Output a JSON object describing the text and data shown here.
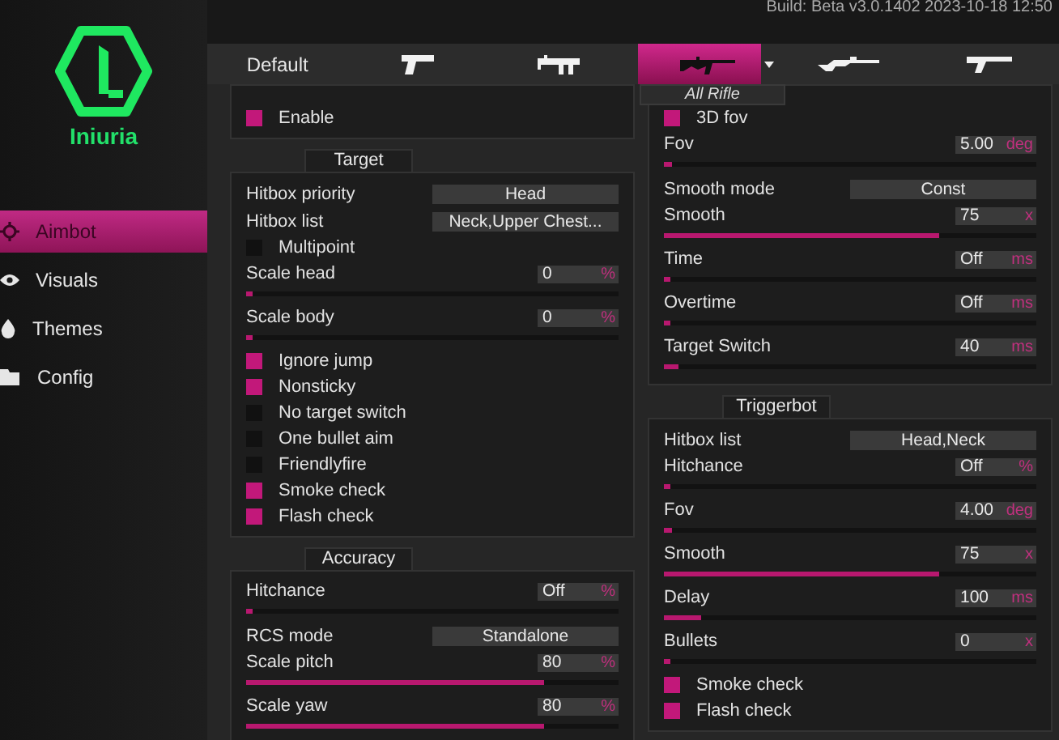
{
  "brand": {
    "name": "Iniuria"
  },
  "build": "Build: Beta v3.0.1402 2023-10-18 12:50",
  "nav": [
    {
      "label": "Aimbot",
      "selected": true
    },
    {
      "label": "Visuals",
      "selected": false
    },
    {
      "label": "Themes",
      "selected": false
    },
    {
      "label": "Config",
      "selected": false
    }
  ],
  "weapon_tabs": [
    {
      "kind": "text",
      "label": "Default",
      "selected": false
    },
    {
      "kind": "pistol",
      "selected": false
    },
    {
      "kind": "smg",
      "selected": false
    },
    {
      "kind": "rifle",
      "selected": true
    },
    {
      "kind": "sniper",
      "selected": false
    },
    {
      "kind": "heavy",
      "selected": false
    }
  ],
  "weapon_dropdown": {
    "label": "All Rifle"
  },
  "columns": [
    {
      "groups": [
        {
          "rows": [
            {
              "kind": "checkbox",
              "label": "Enable",
              "checked": true
            }
          ]
        },
        {
          "title": "Target",
          "rows": [
            {
              "kind": "select",
              "label": "Hitbox priority",
              "value": "Head"
            },
            {
              "kind": "select",
              "label": "Hitbox list",
              "value": "Neck,Upper Chest..."
            },
            {
              "kind": "checkbox",
              "label": "Multipoint",
              "checked": false
            },
            {
              "kind": "slider",
              "label": "Scale head",
              "value": "0",
              "unit": "%",
              "level": 0.0
            },
            {
              "kind": "slider",
              "label": "Scale body",
              "value": "0",
              "unit": "%",
              "level": 0.0
            },
            {
              "kind": "checkbox",
              "label": "Ignore jump",
              "checked": true
            },
            {
              "kind": "checkbox",
              "label": "Nonsticky",
              "checked": true
            },
            {
              "kind": "checkbox",
              "label": "No target switch",
              "checked": false
            },
            {
              "kind": "checkbox",
              "label": "One bullet aim",
              "checked": false
            },
            {
              "kind": "checkbox",
              "label": "Friendlyfire",
              "checked": false
            },
            {
              "kind": "checkbox",
              "label": "Smoke check",
              "checked": true
            },
            {
              "kind": "checkbox",
              "label": "Flash check",
              "checked": true
            }
          ]
        },
        {
          "title": "Accuracy",
          "rows": [
            {
              "kind": "slider",
              "label": "Hitchance",
              "value": "Off",
              "unit": "%",
              "level": 0.0
            },
            {
              "kind": "select",
              "label": "RCS mode",
              "value": "Standalone"
            },
            {
              "kind": "slider",
              "label": "Scale pitch",
              "value": "80",
              "unit": "%",
              "level": 0.8
            },
            {
              "kind": "slider",
              "label": "Scale yaw",
              "value": "80",
              "unit": "%",
              "level": 0.8
            }
          ]
        }
      ]
    },
    {
      "groups": [
        {
          "rows": [
            {
              "kind": "checkbox",
              "label": "3D fov",
              "checked": true
            },
            {
              "kind": "slider",
              "label": "Fov",
              "value": "5.00",
              "unit": "deg",
              "level": 0.02
            },
            {
              "kind": "select",
              "label": "Smooth mode",
              "value": "Const"
            },
            {
              "kind": "slider",
              "label": "Smooth",
              "value": "75",
              "unit": "x",
              "level": 0.74
            },
            {
              "kind": "slider",
              "label": "Time",
              "value": "Off",
              "unit": "ms",
              "level": 0.0
            },
            {
              "kind": "slider",
              "label": "Overtime",
              "value": "Off",
              "unit": "ms",
              "level": 0.0
            },
            {
              "kind": "slider",
              "label": "Target Switch",
              "value": "40",
              "unit": "ms",
              "level": 0.04
            }
          ]
        },
        {
          "title": "Triggerbot",
          "rows": [
            {
              "kind": "select",
              "label": "Hitbox list",
              "value": "Head,Neck"
            },
            {
              "kind": "slider",
              "label": "Hitchance",
              "value": "Off",
              "unit": "%",
              "level": 0.0
            },
            {
              "kind": "slider",
              "label": "Fov",
              "value": "4.00",
              "unit": "deg",
              "level": 0.02
            },
            {
              "kind": "slider",
              "label": "Smooth",
              "value": "75",
              "unit": "x",
              "level": 0.74
            },
            {
              "kind": "slider",
              "label": "Delay",
              "value": "100",
              "unit": "ms",
              "level": 0.1
            },
            {
              "kind": "slider",
              "label": "Bullets",
              "value": "0",
              "unit": "x",
              "level": 0.0
            },
            {
              "kind": "checkbox",
              "label": "Smoke check",
              "checked": true
            },
            {
              "kind": "checkbox",
              "label": "Flash check",
              "checked": true
            }
          ]
        }
      ]
    }
  ]
}
